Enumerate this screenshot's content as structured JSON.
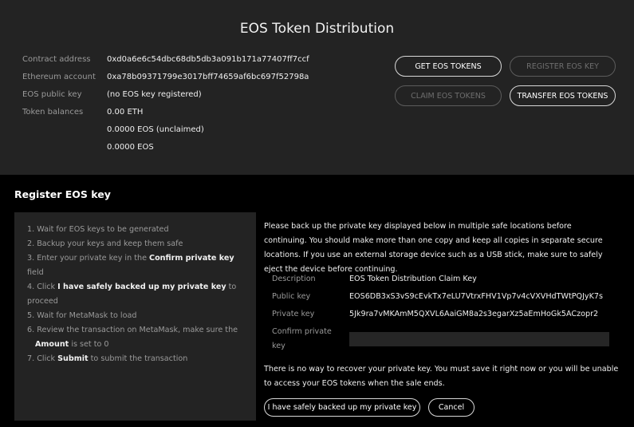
{
  "header": {
    "title": "EOS Token Distribution"
  },
  "info": [
    {
      "label": "Contract address",
      "value": "0xd0a6e6c54dbc68db5db3a091b171a77407ff7ccf"
    },
    {
      "label": "Ethereum account",
      "value": "0xa78b09371799e3017bff74659af6bc697f52798a"
    },
    {
      "label": "EOS public key",
      "value": "(no EOS key registered)"
    },
    {
      "label": "Token balances",
      "value": "0.00 ETH"
    },
    {
      "label": "",
      "value": "0.0000 EOS (unclaimed)"
    },
    {
      "label": "",
      "value": "0.0000 EOS"
    }
  ],
  "actions": {
    "get_tokens": "GET EOS TOKENS",
    "register_key": "REGISTER EOS KEY",
    "claim_tokens": "CLAIM EOS TOKENS",
    "transfer_tokens": "TRANSFER EOS TOKENS"
  },
  "register": {
    "title": "Register EOS key",
    "steps": [
      {
        "pre": "1. Wait for EOS keys to be generated",
        "bold": "",
        "post": ""
      },
      {
        "pre": "2. Backup your keys and keep them safe",
        "bold": "",
        "post": ""
      },
      {
        "pre": "3. Enter your private key in the ",
        "bold": "Confirm private key",
        "post": " field"
      },
      {
        "pre": "4. Click ",
        "bold": "I have safely backed up my private key",
        "post": " to proceed"
      },
      {
        "pre": "5. Wait for MetaMask to load",
        "bold": "",
        "post": ""
      },
      {
        "pre": "6. Review the transaction on MetaMask, make sure the ",
        "bold": "",
        "post": ""
      },
      {
        "pre": "",
        "bold": "Amount",
        "post": " is set to 0"
      },
      {
        "pre": "7. Click ",
        "bold": "Submit",
        "post": " to submit the transaction"
      }
    ],
    "backup_notice": "Please back up the private key displayed below in multiple safe locations before continuing. You should make more than one copy and keep all copies in separate secure locations. If you use an external storage device such as a USB stick, make sure to safely eject the device before continuing.",
    "fields": {
      "description_label": "Description",
      "description_value": "EOS Token Distribution Claim Key",
      "public_key_label": "Public key",
      "public_key_value": "EOS6DB3xS3vS9cEvkTx7eLU7VtrxFHV1Vp7v4cVXVHdTWtPQJyK7s",
      "private_key_label": "Private key",
      "private_key_value": "5Jk9ra7vMKAmM5QXVL6AaiGM8a2s3egarXz5aEmHoGk5ACzopr2",
      "confirm_label": "Confirm private key",
      "confirm_value": "",
      "confirm_placeholder": ""
    },
    "warning": "There is no way to recover your private key. You must save it right now or you will be unable to access your EOS tokens when the sale ends.",
    "backed_up_button": "I have safely backed up my private key",
    "cancel_button": "Cancel"
  }
}
